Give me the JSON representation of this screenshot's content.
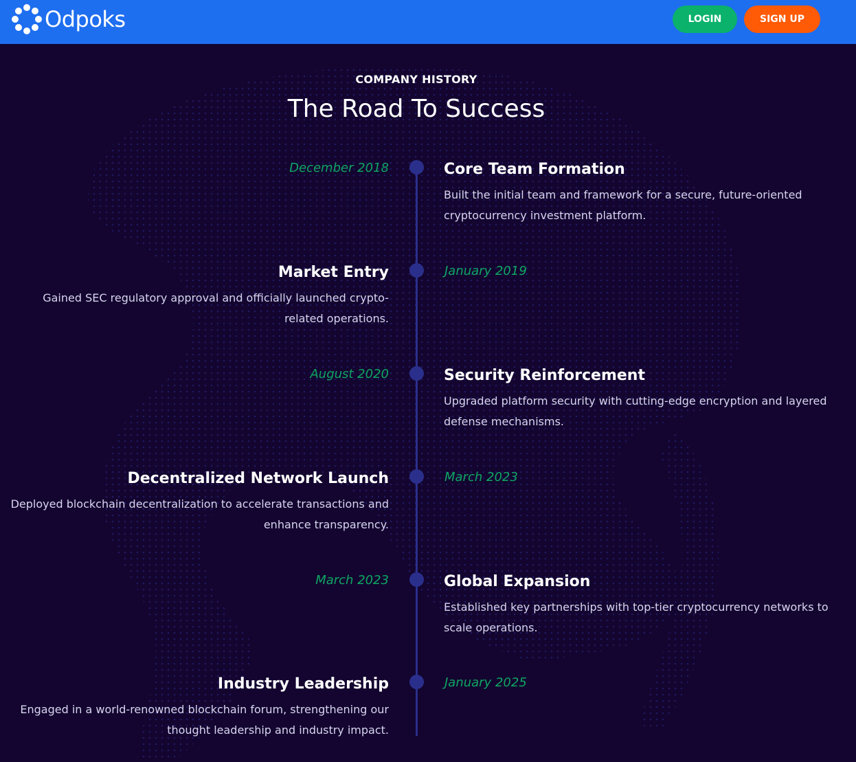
{
  "header": {
    "brand": "Odpoks",
    "login_label": "LOGIN",
    "signup_label": "SIGN UP",
    "colors": {
      "bar": "#1e6ef0",
      "login": "#0ab26b",
      "signup": "#ff5a06"
    }
  },
  "section": {
    "eyebrow": "COMPANY HISTORY",
    "title": "The Road To Success"
  },
  "timeline": [
    {
      "date": "December 2018",
      "title": "Core Team Formation",
      "description": "Built the initial team and framework for a secure, future-oriented cryptocurrency investment platform."
    },
    {
      "date": "January 2019",
      "title": "Market Entry",
      "description": "Gained SEC regulatory approval and officially launched crypto-related operations."
    },
    {
      "date": "August 2020",
      "title": "Security Reinforcement",
      "description": "Upgraded platform security with cutting-edge encryption and layered defense mechanisms."
    },
    {
      "date": "March 2023",
      "title": "Decentralized Network Launch",
      "description": "Deployed blockchain decentralization to accelerate transactions and enhance transparency."
    },
    {
      "date": "March 2023",
      "title": "Global Expansion",
      "description": "Established key partnerships with top-tier cryptocurrency networks to scale operations."
    },
    {
      "date": "January 2025",
      "title": "Industry Leadership",
      "description": "Engaged in a world-renowned blockchain forum, strengthening our thought leadership and industry impact."
    }
  ],
  "theme": {
    "background": "#13052f",
    "date_color": "#0fa664",
    "line_color": "#2b2f8c"
  },
  "icons": {
    "logo": "ring-of-dots-logo-icon"
  }
}
